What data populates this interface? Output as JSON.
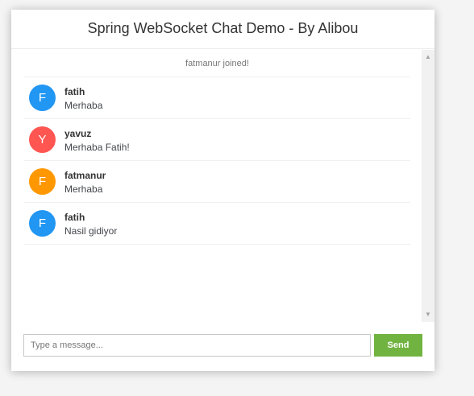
{
  "header": {
    "title": "Spring WebSocket Chat Demo - By Alibou"
  },
  "messages": {
    "event": "fatmanur joined!",
    "items": [
      {
        "avatar_letter": "F",
        "sender": "fatih",
        "text": "Merhaba",
        "avatar_color": "#2196f3"
      },
      {
        "avatar_letter": "Y",
        "sender": "yavuz",
        "text": "Merhaba Fatih!",
        "avatar_color": "#ff5652"
      },
      {
        "avatar_letter": "F",
        "sender": "fatmanur",
        "text": "Merhaba",
        "avatar_color": "#ff9800"
      },
      {
        "avatar_letter": "F",
        "sender": "fatih",
        "text": "Nasil gidiyor",
        "avatar_color": "#2196f3"
      }
    ]
  },
  "scrollbar": {
    "up_icon": "triangle-up",
    "down_icon": "triangle-down"
  },
  "form": {
    "input_placeholder": "Type a message...",
    "input_value": "",
    "send_label": "Send"
  },
  "colors": {
    "send_button": "#71b340",
    "page_background": "#f4f4f4"
  }
}
